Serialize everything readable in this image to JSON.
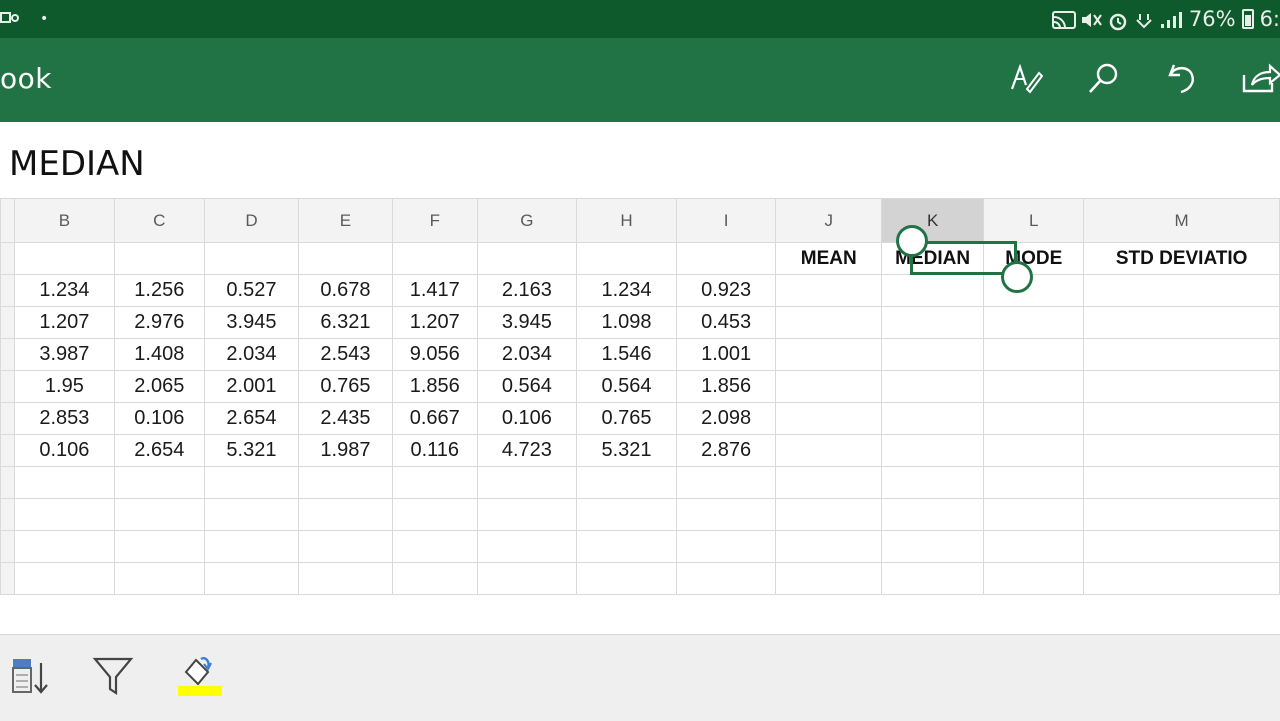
{
  "status_bar": {
    "battery": "76%",
    "time": "6:",
    "icons": [
      "cast-icon",
      "mute-icon",
      "alarm-icon",
      "wifi-icon",
      "signal-icon",
      "battery-icon"
    ]
  },
  "app_bar": {
    "title": "ook",
    "actions": [
      "draw-icon",
      "search-icon",
      "undo-icon",
      "share-icon"
    ]
  },
  "formula_bar": {
    "content": "MEDIAN"
  },
  "sheet": {
    "columns": [
      "B",
      "C",
      "D",
      "E",
      "F",
      "G",
      "H",
      "I",
      "J",
      "K",
      "L",
      "M"
    ],
    "selected_column": "K",
    "labels": [
      "",
      "",
      "",
      "",
      "",
      "",
      "",
      "",
      "MEAN",
      "MEDIAN",
      "MODE",
      "STD DEVIATIO"
    ],
    "rows": [
      [
        "1.234",
        "1.256",
        "0.527",
        "0.678",
        "1.417",
        "2.163",
        "1.234",
        "0.923"
      ],
      [
        "1.207",
        "2.976",
        "3.945",
        "6.321",
        "1.207",
        "3.945",
        "1.098",
        "0.453"
      ],
      [
        "3.987",
        "1.408",
        "2.034",
        "2.543",
        "9.056",
        "2.034",
        "1.546",
        "1.001"
      ],
      [
        "1.95",
        "2.065",
        "2.001",
        "0.765",
        "1.856",
        "0.564",
        "0.564",
        "1.856"
      ],
      [
        "2.853",
        "0.106",
        "2.654",
        "2.435",
        "0.667",
        "0.106",
        "0.765",
        "2.098"
      ],
      [
        "0.106",
        "2.654",
        "5.321",
        "1.987",
        "0.116",
        "4.723",
        "5.321",
        "2.876"
      ]
    ]
  },
  "bottom_toolbar": {
    "tools": [
      "sort-icon",
      "filter-icon",
      "fill-color-icon"
    ],
    "fill_color": "#ffff00"
  },
  "colors": {
    "status_bar": "#0f5a2c",
    "app_bar": "#217346",
    "selection": "#217346"
  }
}
